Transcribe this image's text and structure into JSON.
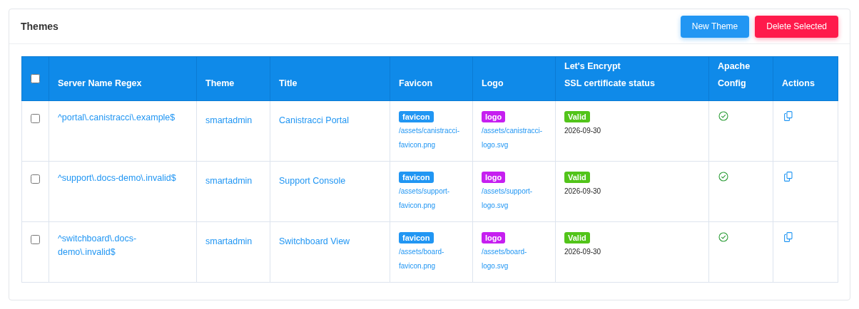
{
  "card": {
    "title": "Themes",
    "buttons": [
      {
        "label": "New Theme",
        "kind": "primary"
      },
      {
        "label": "Delete Selected",
        "kind": "danger"
      }
    ]
  },
  "table": {
    "select_all": {
      "checked": false
    },
    "columns": [
      "Server Name Regex",
      "Theme",
      "Title",
      "Favicon",
      "Logo",
      "Let's Encrypt\nSSL certificate status",
      "Apache\nConfig",
      "Actions"
    ],
    "rows": [
      {
        "checked": false,
        "regex": "^portal\\.canistracci\\.example$",
        "theme": "smartadmin",
        "title": "Canistracci Portal",
        "favicon": {
          "badge": "favicon",
          "path": "/assets/canistracci-favicon.png"
        },
        "logo": {
          "badge": "logo",
          "path": "/assets/canistracci-logo.svg"
        },
        "ssl": {
          "status": "Valid",
          "date": "2026-09-30"
        }
      },
      {
        "checked": false,
        "regex": "^support\\.docs-demo\\.invalid$",
        "theme": "smartadmin",
        "title": "Support Console",
        "favicon": {
          "badge": "favicon",
          "path": "/assets/support-favicon.png"
        },
        "logo": {
          "badge": "logo",
          "path": "/assets/support-logo.svg"
        },
        "ssl": {
          "status": "Valid",
          "date": "2026-09-30"
        }
      },
      {
        "checked": false,
        "regex": "^switchboard\\.docs-demo\\.invalid$",
        "theme": "smartadmin",
        "title": "Switchboard View",
        "favicon": {
          "badge": "favicon",
          "path": "/assets/board-favicon.png"
        },
        "logo": {
          "badge": "logo",
          "path": "/assets/board-logo.svg"
        },
        "ssl": {
          "status": "Valid",
          "date": "2026-09-30"
        }
      }
    ]
  }
}
